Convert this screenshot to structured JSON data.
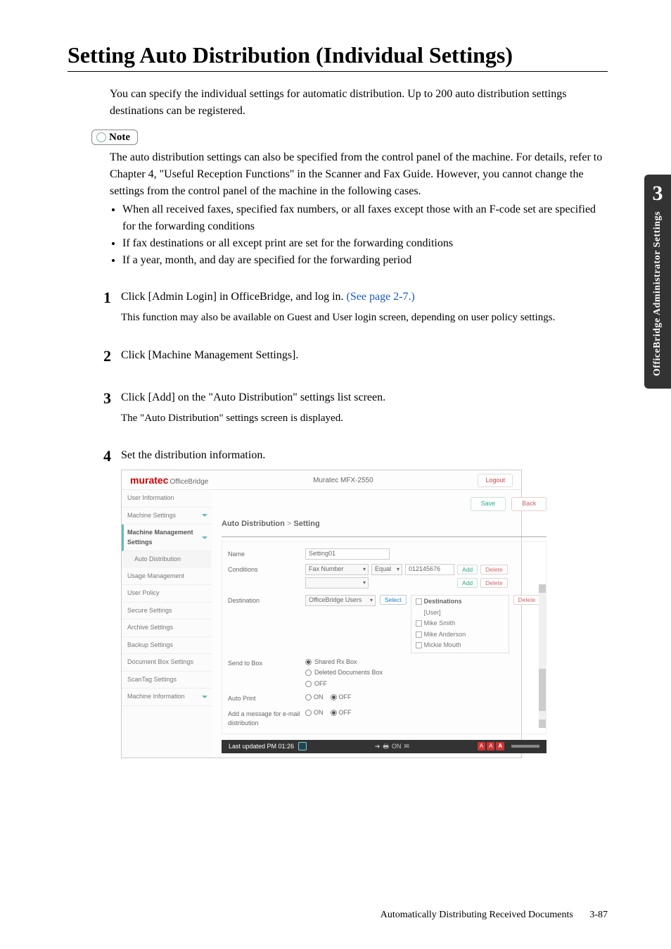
{
  "title": "Setting Auto Distribution (Individual Settings)",
  "intro": "You can specify the individual settings for automatic distribution. Up to 200 auto distribution settings destinations can be registered.",
  "side_tab": {
    "num": "3",
    "text": "OfficeBridge Administrator Settings"
  },
  "note": {
    "label": "Note",
    "body": "The auto distribution settings can also be specified from the control panel of the machine. For details, refer to Chapter 4, \"Useful Reception Functions\" in the Scanner and Fax Guide. However, you cannot change the settings from the control panel of the machine in the following cases.",
    "bullets": [
      "When all received faxes, specified fax numbers, or all faxes except those with an F-code set are specified for the forwarding conditions",
      "If fax destinations or all except print are set for the forwarding conditions",
      "If a year, month, and day are specified for the forwarding period"
    ]
  },
  "steps": [
    {
      "num": "1",
      "main_pre": "Click [Admin Login] in OfficeBridge, and log in. ",
      "link": "(See page 2-7.)",
      "sub": "This function may also be available on Guest and User login screen, depending on user policy settings."
    },
    {
      "num": "2",
      "main": "Click [Machine Management Settings]."
    },
    {
      "num": "3",
      "main": "Click [Add] on the \"Auto Distribution\" settings list screen.",
      "sub": "The \"Auto Distribution\" settings screen is displayed."
    },
    {
      "num": "4",
      "main": "Set the distribution information."
    }
  ],
  "screenshot": {
    "brand": "muratec",
    "brand_sub": "OfficeBridge",
    "model": "Muratec MFX-2550",
    "logout": "Logout",
    "sidebar": {
      "user_info": "User Information",
      "machine_settings": "Machine Settings",
      "mms": "Machine Management Settings",
      "auto_dist": "Auto Distribution",
      "usage": "Usage Management",
      "user_policy": "User Policy",
      "secure": "Secure Settings",
      "archive": "Archive Settings",
      "backup": "Backup Settings",
      "docbox": "Document Box Settings",
      "scantag": "ScanTag Settings",
      "machine_info": "Machine Information"
    },
    "topbtns": {
      "save": "Save",
      "back": "Back"
    },
    "breadcrumb": {
      "a": "Auto Distribution",
      "sep": ">",
      "b": "Setting"
    },
    "form": {
      "name_label": "Name",
      "name_value": "Setting01",
      "cond_label": "Conditions",
      "cond_type": "Fax Number",
      "cond_op": "Equal",
      "cond_val": "012145676",
      "add": "Add",
      "delete": "Delete",
      "dest_label": "Destination",
      "dest_type": "OfficeBridge Users",
      "select_btn": "Select",
      "dest_header": "Destinations",
      "dest_group": "[User]",
      "dest_items": [
        "Mike Smith",
        "Mike Anderson",
        "Mickie Mouth"
      ],
      "send_label": "Send to Box",
      "send_opts": [
        "Shared Rx Box",
        "Deleted Documents Box",
        "OFF"
      ],
      "autoprint_label": "Auto Print",
      "on": "ON",
      "off": "OFF",
      "addmsg_label": "Add a message for e-mail distribution"
    },
    "statusbar": {
      "updated": "Last updated PM 01:26",
      "on": "ON"
    }
  },
  "footer": {
    "section": "Automatically Distributing Received Documents",
    "page": "3-87"
  }
}
